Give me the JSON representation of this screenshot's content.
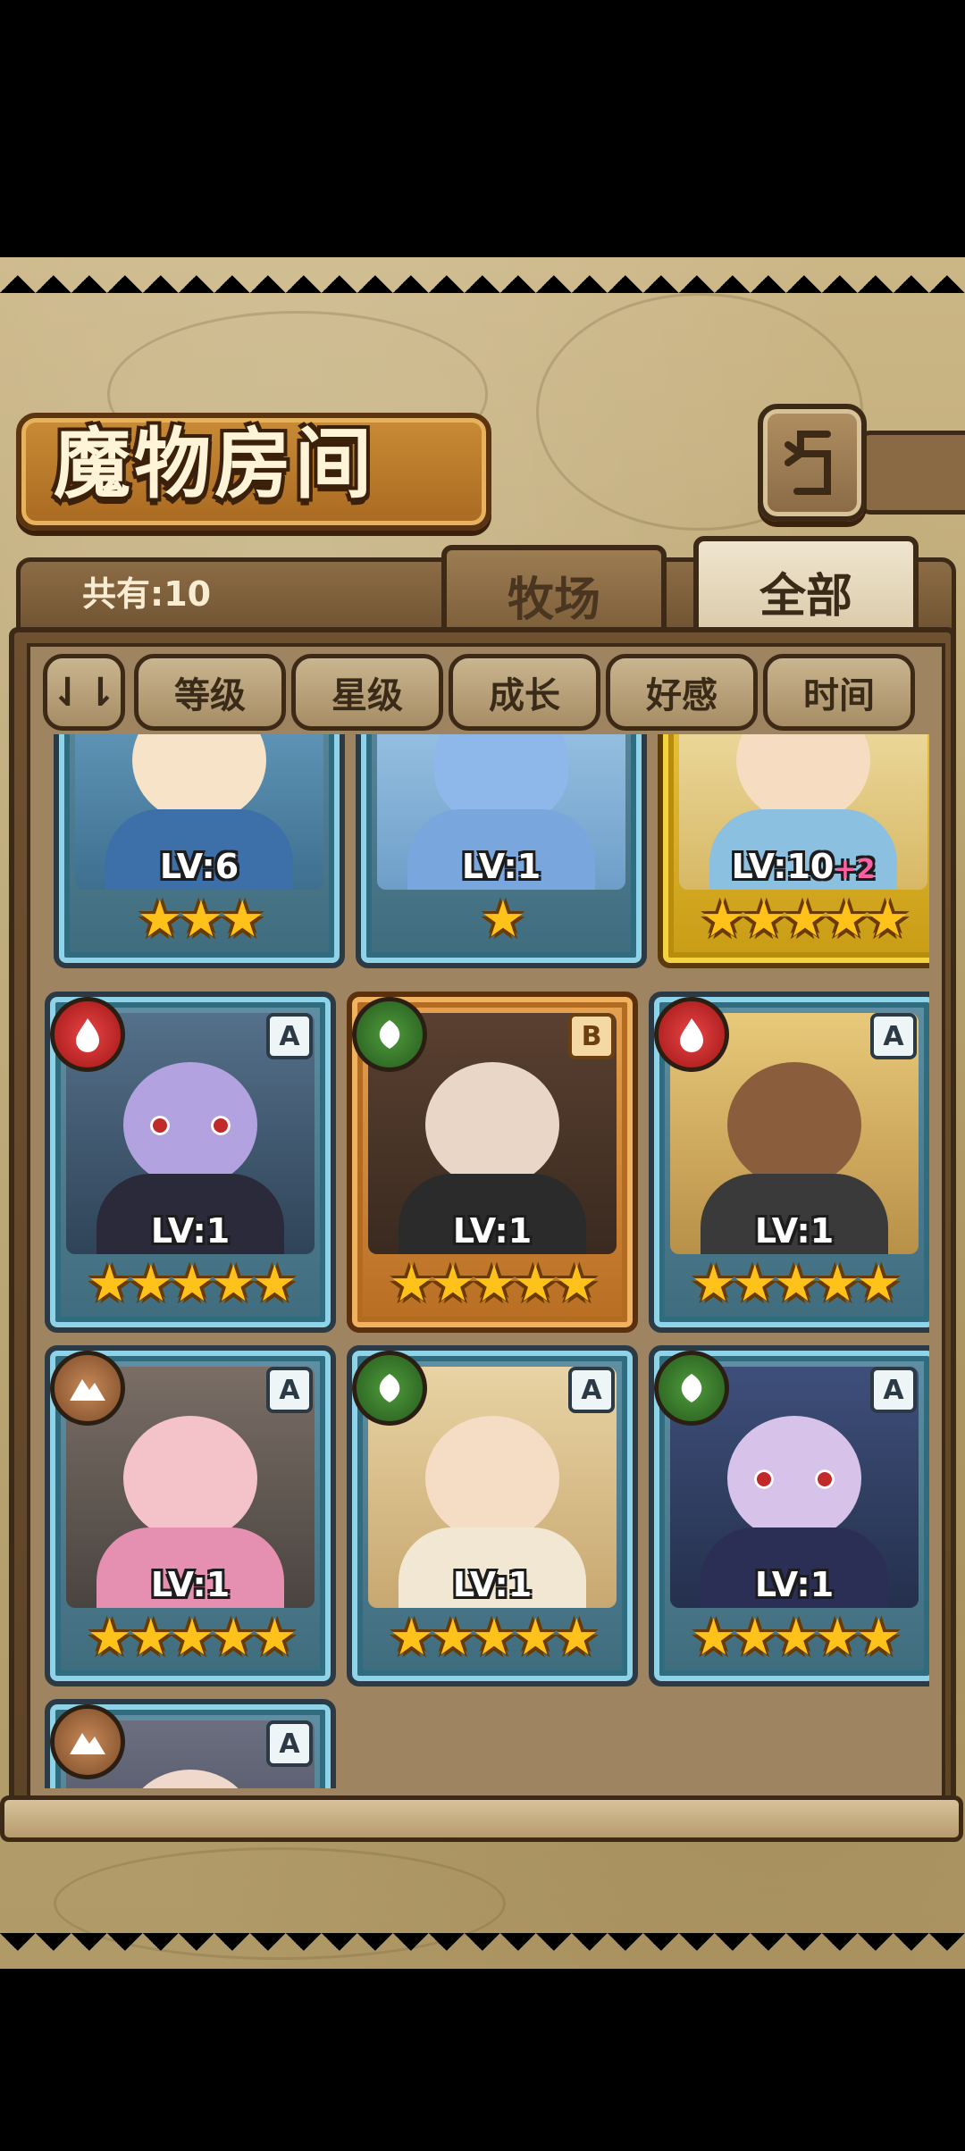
{
  "header": {
    "title": "魔物房间"
  },
  "tabs": {
    "count_label": "共有:10",
    "ranch": "牧场",
    "all": "全部"
  },
  "sort": {
    "toggle": "⇃⇂",
    "level": "等级",
    "star": "星级",
    "growth": "成长",
    "affection": "好感",
    "time": "时间"
  },
  "cards": [
    {
      "level": "LV:6",
      "stars": "★★★",
      "element": "",
      "rank": ""
    },
    {
      "level": "LV:1",
      "stars": "★",
      "element": "",
      "rank": ""
    },
    {
      "level": "LV:10",
      "bonus": "+2",
      "stars": "★★★★★",
      "element": "",
      "rank": ""
    },
    {
      "level": "LV:1",
      "stars": "★★★★★",
      "element": "fire",
      "rank": "A"
    },
    {
      "level": "LV:1",
      "stars": "★★★★★",
      "element": "grass",
      "rank": "B"
    },
    {
      "level": "LV:1",
      "stars": "★★★★★",
      "element": "fire",
      "rank": "A"
    },
    {
      "level": "LV:1",
      "stars": "★★★★★",
      "element": "earth",
      "rank": "A"
    },
    {
      "level": "LV:1",
      "stars": "★★★★★",
      "element": "grass",
      "rank": "A"
    },
    {
      "level": "LV:1",
      "stars": "★★★★★",
      "element": "grass",
      "rank": "A"
    },
    {
      "level": "",
      "stars": "",
      "element": "earth",
      "rank": "A"
    }
  ],
  "colors": {
    "accent_gold": "#f0cf44",
    "frame_blue": "#8fd3e8",
    "parchment": "#cbb686"
  }
}
